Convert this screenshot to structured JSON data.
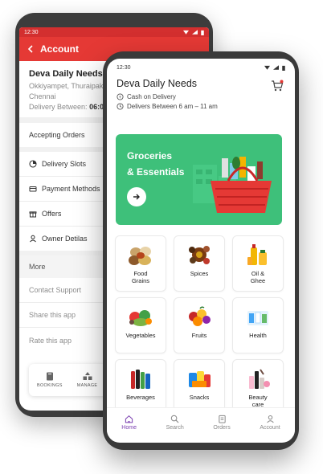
{
  "back": {
    "status_time": "12:30",
    "header_title": "Account",
    "shop_name": "Deva Daily Needs",
    "address_line1": "Okkiyampet, Thuraipakk",
    "address_line2": "Chennai",
    "delivery_label": "Delivery Between:",
    "delivery_value": "06:00",
    "menu": {
      "accepting_orders": "Accepting Orders",
      "delivery_slots": "Delivery Slots",
      "payment_methods": "Payment Methods",
      "offers": "Offers",
      "owner_details": "Owner Detilas",
      "more": "More",
      "contact_support": "Contact Support",
      "share_app": "Share this app",
      "rate_app": "Rate this app"
    },
    "bottom_nav": {
      "bookings": "BOOKINGS",
      "manage": "MANAGE"
    }
  },
  "front": {
    "status_time": "12:30",
    "store_name": "Deva Daily Needs",
    "payment_info": "Cash on Delivery",
    "delivery_info": "Delivers Between 6 am – 11 am",
    "banner": {
      "line1": "Groceries",
      "line2": "& Essentials"
    },
    "categories": [
      {
        "label": "Food\nGrains",
        "l1": "Food",
        "l2": "Grains",
        "icon": "grains-icon"
      },
      {
        "label": "Spices",
        "l1": "Spices",
        "l2": "",
        "icon": "spices-icon"
      },
      {
        "label": "Oil & Ghee",
        "l1": "Oil &",
        "l2": "Ghee",
        "icon": "oil-icon"
      },
      {
        "label": "Vegetables",
        "l1": "Vegetables",
        "l2": "",
        "icon": "vegetables-icon"
      },
      {
        "label": "Fruits",
        "l1": "Fruits",
        "l2": "",
        "icon": "fruits-icon"
      },
      {
        "label": "Health",
        "l1": "Health",
        "l2": "",
        "icon": "health-icon"
      },
      {
        "label": "Beverages",
        "l1": "Beverages",
        "l2": "",
        "icon": "beverages-icon"
      },
      {
        "label": "Snacks",
        "l1": "Snacks",
        "l2": "",
        "icon": "snacks-icon"
      },
      {
        "label": "Beauty care",
        "l1": "Beauty",
        "l2": "care",
        "icon": "beauty-icon"
      }
    ],
    "nav": {
      "home": "Home",
      "search": "Search",
      "orders": "Orders",
      "account": "Account"
    }
  },
  "colors": {
    "back_header": "#e53935",
    "banner_green": "#3ec07a",
    "nav_active": "#7a3fb0"
  }
}
